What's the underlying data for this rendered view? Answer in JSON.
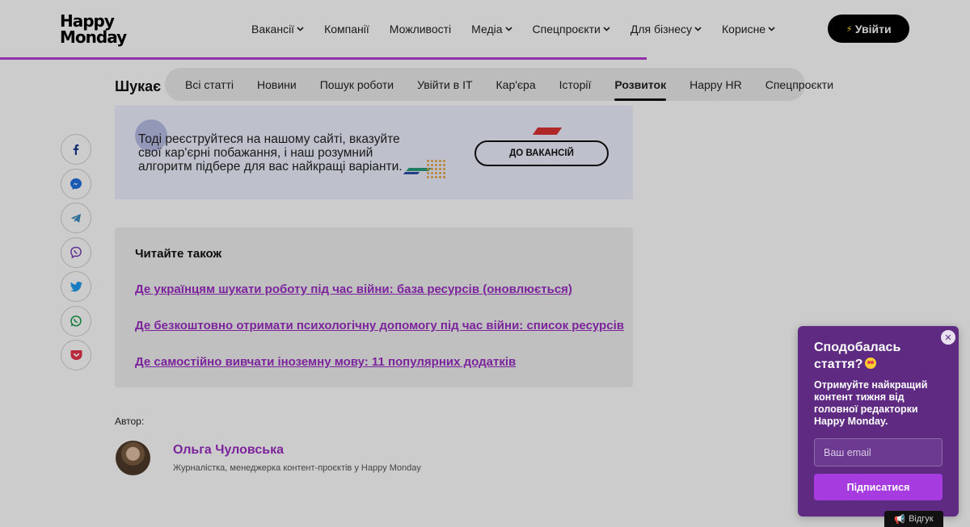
{
  "header": {
    "logo_line1": "Happy",
    "logo_line2": "Monday",
    "nav": [
      {
        "label": "Вакансії",
        "dropdown": true
      },
      {
        "label": "Компанії",
        "dropdown": false
      },
      {
        "label": "Можливості",
        "dropdown": false
      },
      {
        "label": "Медіа",
        "dropdown": true
      },
      {
        "label": "Спецпроєкти",
        "dropdown": true
      },
      {
        "label": "Для бізнесу",
        "dropdown": true
      },
      {
        "label": "Корисне",
        "dropdown": true
      }
    ],
    "login_label": "Увійти",
    "reading_progress_percent": 66.7
  },
  "page_heading": "Шукає",
  "tabs": [
    {
      "label": "Всі статті",
      "active": false
    },
    {
      "label": "Новини",
      "active": false
    },
    {
      "label": "Пошук роботи",
      "active": false
    },
    {
      "label": "Увійти в ІТ",
      "active": false
    },
    {
      "label": "Кар'єра",
      "active": false
    },
    {
      "label": "Історії",
      "active": false
    },
    {
      "label": "Розвиток",
      "active": true
    },
    {
      "label": "Happy HR",
      "active": false
    },
    {
      "label": "Спецпроєкти",
      "active": false
    }
  ],
  "share": [
    "facebook-icon",
    "messenger-icon",
    "telegram-icon",
    "viber-icon",
    "twitter-icon",
    "whatsapp-icon",
    "pocket-icon"
  ],
  "banner": {
    "text": "Тоді реєструйтеся на нашому сайті, вказуйте свої кар'єрні побажання, і наш розумний алгоритм підбере для вас найкращі варіанти.",
    "button": "ДО ВАКАНСІЙ"
  },
  "read_also": {
    "title": "Читайте також",
    "links": [
      "Де українцям шукати роботу під час війни: база ресурсів (оновлюється)",
      "Де безкоштовно отримати психологічну допомогу під час війни: список ресурсів",
      "Де самостійно вивчати іноземну мову: 11 популярних додатків"
    ]
  },
  "author": {
    "label": "Автор:",
    "name": "Ольга Чуловська",
    "role": "Журналістка, менеджерка контент-проєктів у Happy Monday"
  },
  "popup": {
    "title": "Сподобалась стаття?",
    "description": "Отримуйте найкращий контент тижня від головної редакторки Happy Monday.",
    "email_placeholder": "Ваш email",
    "submit": "Підписатися"
  },
  "feedback": "Відгук",
  "colors": {
    "accent": "#9b2ec4",
    "popup_bg": "#5e2a82",
    "progress": "#b43fd6"
  }
}
